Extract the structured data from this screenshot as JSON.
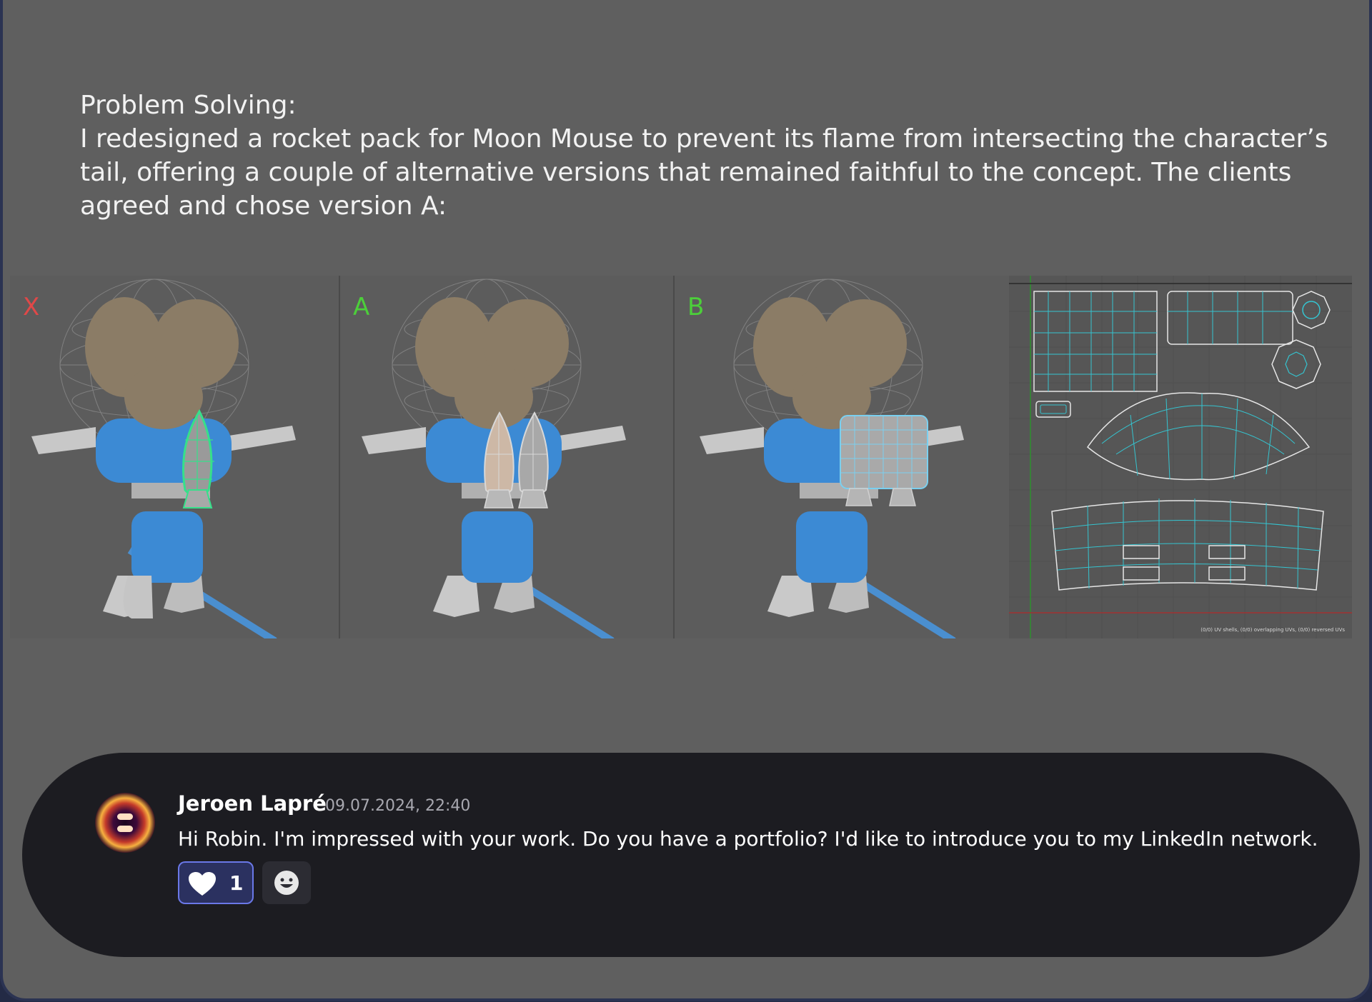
{
  "post": {
    "heading": "Problem Solving:",
    "body": "I redesigned a rocket pack for Moon Mouse to prevent its flame from intersecting the character’s tail, offering a couple of alternative versions that remained faithful to the concept. The clients agreed and chose version A:"
  },
  "panels": [
    {
      "label": "X",
      "color": "#e04848"
    },
    {
      "label": "A",
      "color": "#4ccf3a"
    },
    {
      "label": "B",
      "color": "#4ccf3a"
    }
  ],
  "uv_editor": {
    "footer": "(0/0) UV shells, (0/0) overlapping UVs, (0/0) reversed UVs"
  },
  "comment": {
    "author": "Jeroen Lapré",
    "timestamp": "09.07.2024, 22:40",
    "message": "Hi Robin. I'm impressed with your work. Do you have a portfolio? I'd like to introduce you to my LinkedIn network.",
    "reaction_icon": "heart-icon",
    "reaction_count": "1",
    "add_reaction_icon": "smiley-icon"
  }
}
